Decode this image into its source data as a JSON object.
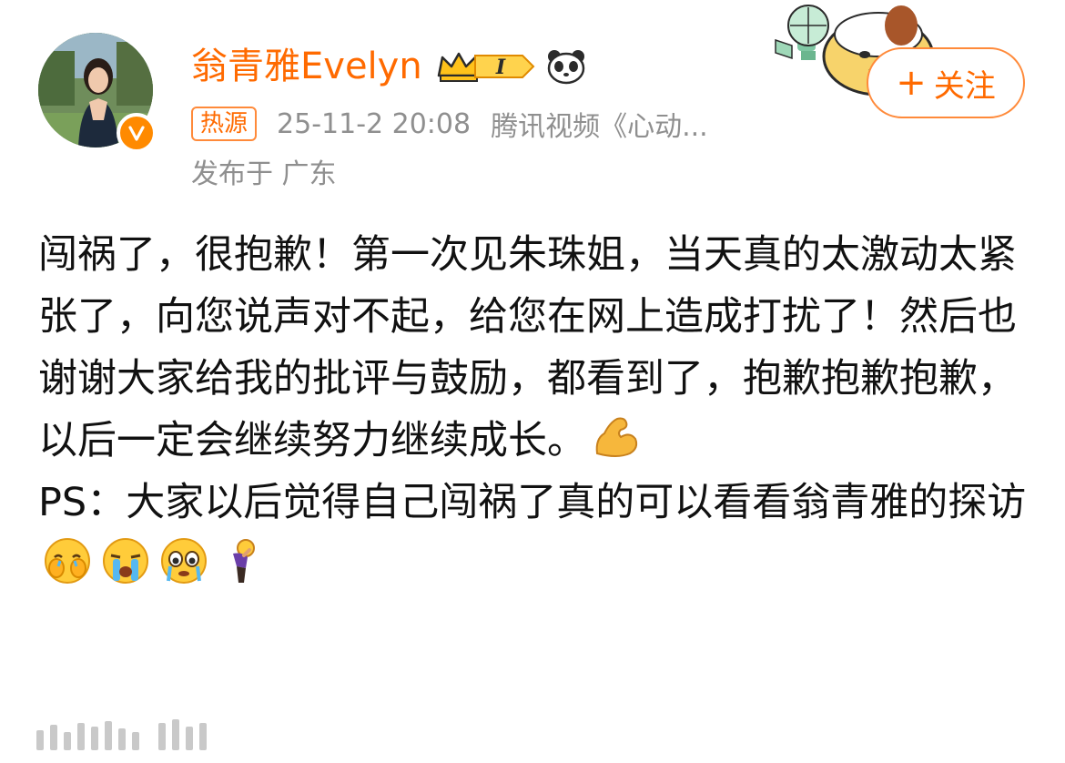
{
  "user": {
    "name": "翁青雅Evelyn",
    "level_badge": "I",
    "verified_mark": "V"
  },
  "meta": {
    "hot_badge": "热源",
    "time": "25-11-2 20:08",
    "source": "腾讯视频《心动...",
    "location": "发布于 广东"
  },
  "follow": {
    "plus": "+",
    "label": "关注"
  },
  "post": {
    "paragraph_1_text": "闯祸了，很抱歉！第一次见朱珠姐，当天真的太激动太紧张了，向您说声对不起，给您在网上造成打扰了！然后也谢谢大家给我的批评与鼓励，都看到了，抱歉抱歉抱歉，以后一定会继续努力继续成长。",
    "paragraph_2_text": "PS：大家以后觉得自己闯祸了真的可以看看翁青雅的探访"
  },
  "icons": {
    "avatar": "profile-photo",
    "verified": "verified-badge-icon",
    "crown": "crown-icon",
    "panda": "panda-icon",
    "sticker": "cartoon-sticker",
    "emojis": [
      "flexed-biceps-icon",
      "hugging-cry-icon",
      "loudly-crying-icon",
      "teary-face-icon",
      "facepalm-figure-icon"
    ]
  },
  "colors": {
    "accent": "#ff6a00",
    "meta_gray": "#8f8f8f",
    "text": "#111111"
  }
}
